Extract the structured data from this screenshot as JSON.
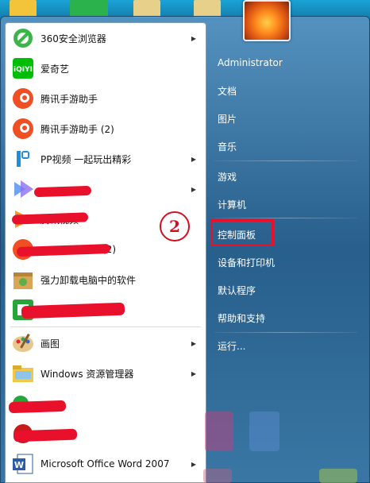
{
  "programs": [
    {
      "label": "360安全浏览器",
      "has_arrow": true,
      "icon": "360-browser-icon"
    },
    {
      "label": "爱奇艺",
      "has_arrow": false,
      "icon": "iqiyi-icon"
    },
    {
      "label": "腾讯手游助手",
      "has_arrow": false,
      "icon": "tencent-mobile-game-assistant-icon"
    },
    {
      "label": "腾讯手游助手 (2)",
      "has_arrow": false,
      "icon": "tencent-mobile-game-assistant-icon"
    },
    {
      "label": "PP视频 一起玩出精彩",
      "has_arrow": true,
      "icon": "pp-video-icon"
    },
    {
      "label": "",
      "has_arrow": true,
      "icon": "app-icon"
    },
    {
      "label": "腾讯视频",
      "has_arrow": false,
      "icon": "tencent-video-icon"
    },
    {
      "label": "(2)",
      "has_arrow": false,
      "icon": "tencent-icon"
    },
    {
      "label": "强力卸载电脑中的软件",
      "has_arrow": false,
      "icon": "uninstall-box-icon"
    },
    {
      "label": "",
      "has_arrow": false,
      "icon": "green-app-icon"
    },
    {
      "label": "画图",
      "has_arrow": true,
      "icon": "paint-icon"
    },
    {
      "label": "Windows 资源管理器",
      "has_arrow": true,
      "icon": "folder-icon"
    },
    {
      "label": "",
      "has_arrow": false,
      "icon": "green-app-icon"
    },
    {
      "label": "",
      "has_arrow": false,
      "icon": "app-icon"
    },
    {
      "label": "Microsoft Office Word 2007",
      "has_arrow": true,
      "icon": "word-icon"
    }
  ],
  "right_pane": {
    "user": "Administrator",
    "documents": "文档",
    "pictures": "图片",
    "music": "音乐",
    "games": "游戏",
    "computer": "计算机",
    "control_panel": "控制面板",
    "devices_printers": "设备和打印机",
    "default_programs": "默认程序",
    "help_support": "帮助和支持",
    "run": "运行..."
  },
  "annotation": {
    "step": "2"
  },
  "colors": {
    "highlight": "#e8102a",
    "menu_blue": "#2a6592"
  }
}
